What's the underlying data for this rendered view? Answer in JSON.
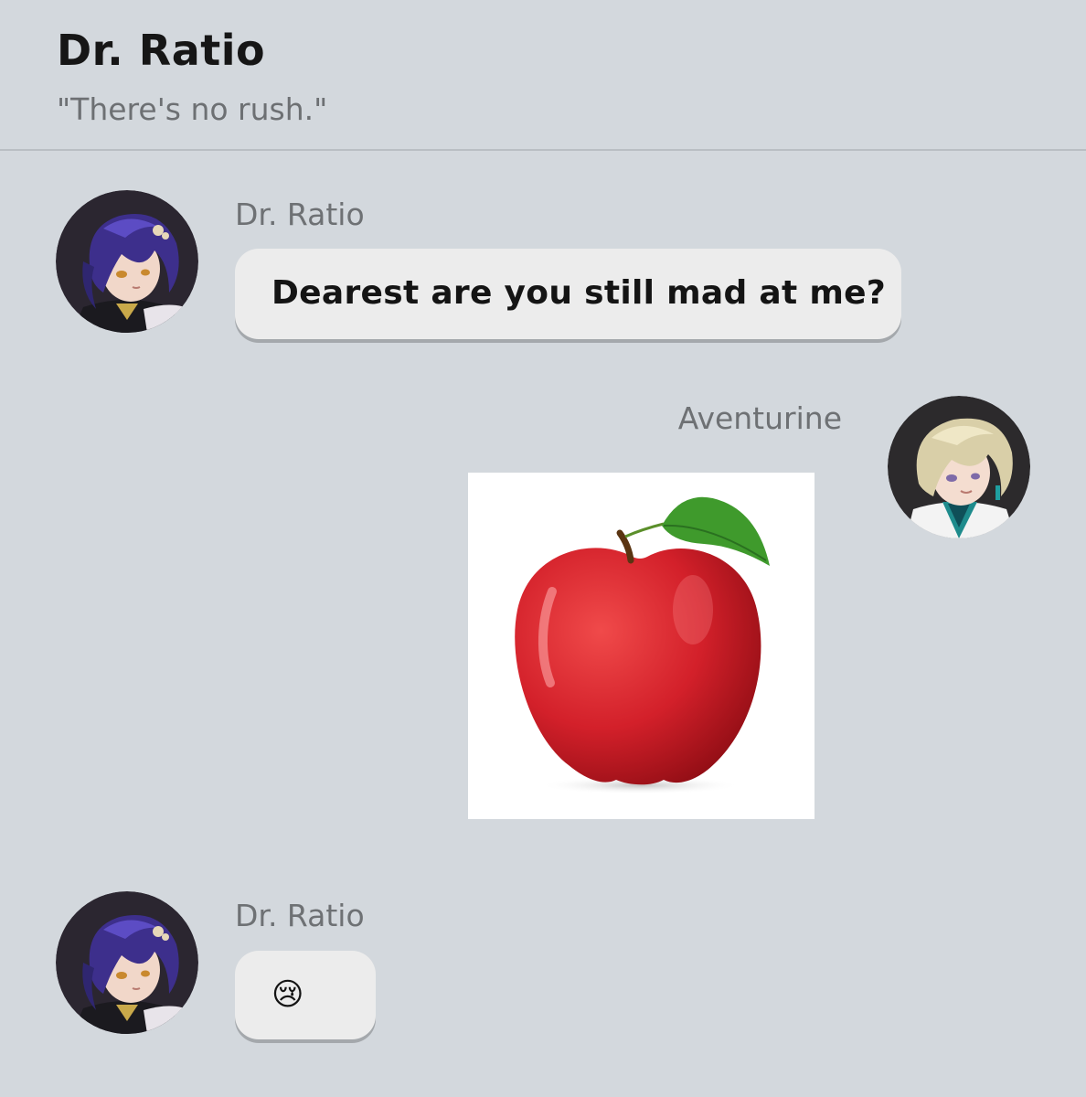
{
  "header": {
    "title": "Dr. Ratio",
    "subtitle": "\"There's no rush.\""
  },
  "messages": [
    {
      "sender": "Dr. Ratio",
      "text": "Dearest are you still mad at me?"
    },
    {
      "sender": "Aventurine",
      "image": "red-apple"
    },
    {
      "sender": "Dr. Ratio",
      "text": "😢"
    }
  ],
  "colors": {
    "background": "#d3d8dd",
    "bubble": "#ececec",
    "bubble_shadow": "#a4a8ac",
    "name_text": "#6e7174",
    "message_text": "#141414",
    "apple_red": "#d3202a"
  },
  "icons": {
    "avatar_ratio": "dr-ratio-avatar",
    "avatar_aventurine": "aventurine-avatar",
    "emoji": "crying-face-emoji"
  }
}
